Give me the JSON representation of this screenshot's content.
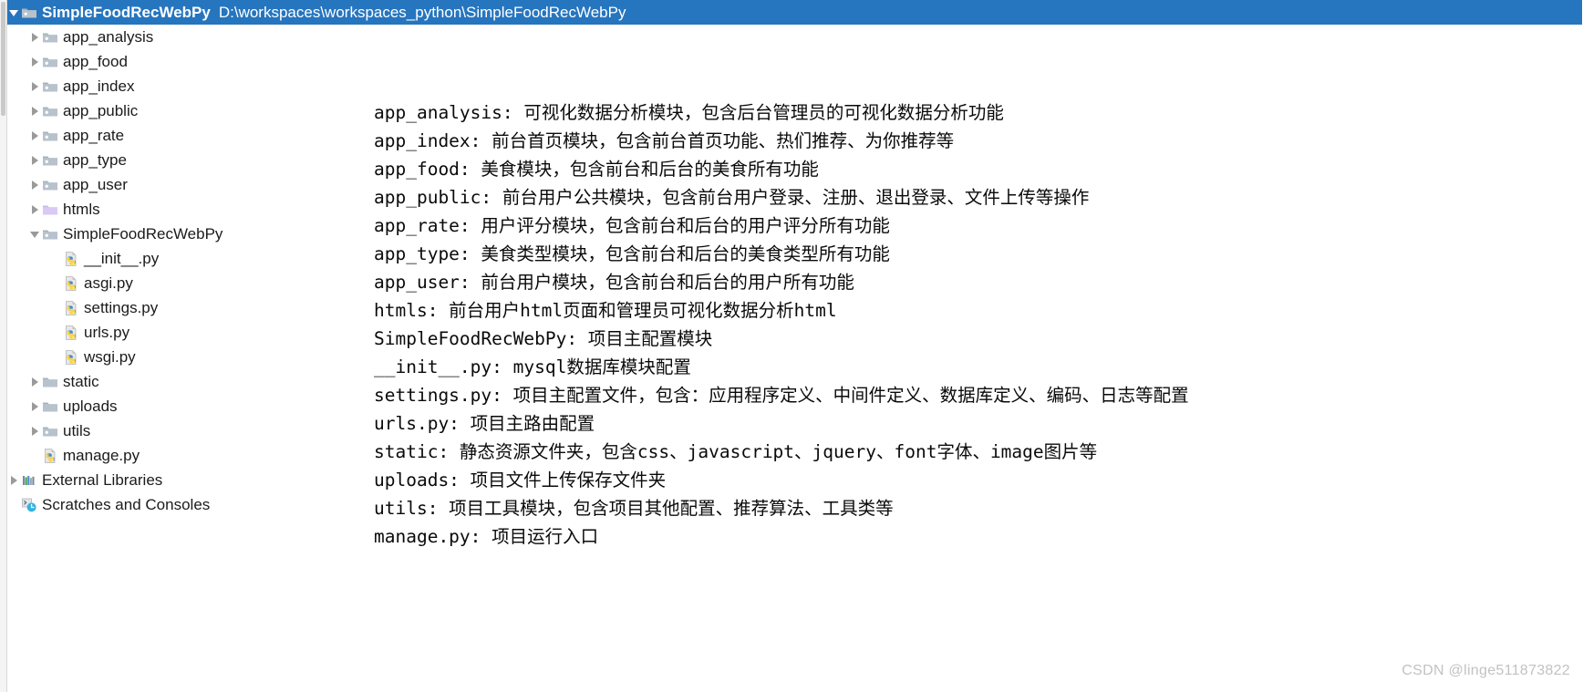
{
  "window": {
    "selected_row": {
      "name": "SimpleFoodRecWebPy",
      "path": "D:\\workspaces\\workspaces_python\\SimpleFoodRecWebPy",
      "highlight_color": "#2675bf"
    }
  },
  "tree": {
    "items": [
      {
        "label": "app_analysis",
        "icon": "module-folder-icon",
        "arrow": "right",
        "indent": 1
      },
      {
        "label": "app_food",
        "icon": "module-folder-icon",
        "arrow": "right",
        "indent": 1
      },
      {
        "label": "app_index",
        "icon": "module-folder-icon",
        "arrow": "right",
        "indent": 1
      },
      {
        "label": "app_public",
        "icon": "module-folder-icon",
        "arrow": "right",
        "indent": 1
      },
      {
        "label": "app_rate",
        "icon": "module-folder-icon",
        "arrow": "right",
        "indent": 1
      },
      {
        "label": "app_type",
        "icon": "module-folder-icon",
        "arrow": "right",
        "indent": 1
      },
      {
        "label": "app_user",
        "icon": "module-folder-icon",
        "arrow": "right",
        "indent": 1
      },
      {
        "label": "htmls",
        "icon": "template-folder-icon",
        "arrow": "right",
        "indent": 1
      },
      {
        "label": "SimpleFoodRecWebPy",
        "icon": "module-folder-icon",
        "arrow": "down",
        "indent": 1
      },
      {
        "label": "__init__.py",
        "icon": "python-file-icon",
        "arrow": "none",
        "indent": 2
      },
      {
        "label": "asgi.py",
        "icon": "python-file-icon",
        "arrow": "none",
        "indent": 2
      },
      {
        "label": "settings.py",
        "icon": "python-file-icon",
        "arrow": "none",
        "indent": 2
      },
      {
        "label": "urls.py",
        "icon": "python-file-icon",
        "arrow": "none",
        "indent": 2
      },
      {
        "label": "wsgi.py",
        "icon": "python-file-icon",
        "arrow": "none",
        "indent": 2
      },
      {
        "label": "static",
        "icon": "folder-icon",
        "arrow": "right",
        "indent": 1
      },
      {
        "label": "uploads",
        "icon": "folder-icon",
        "arrow": "right",
        "indent": 1
      },
      {
        "label": "utils",
        "icon": "module-folder-icon",
        "arrow": "right",
        "indent": 1
      },
      {
        "label": "manage.py",
        "icon": "python-file-icon",
        "arrow": "none",
        "indent": 1
      },
      {
        "label": "External Libraries",
        "icon": "external-libraries-icon",
        "arrow": "right",
        "indent": 0
      },
      {
        "label": "Scratches and Consoles",
        "icon": "scratches-icon",
        "arrow": "none",
        "indent": 0
      }
    ]
  },
  "description": {
    "lines": [
      "app_analysis: 可视化数据分析模块，包含后台管理员的可视化数据分析功能",
      "app_index: 前台首页模块，包含前台首页功能、热们推荐、为你推荐等",
      "app_food: 美食模块，包含前台和后台的美食所有功能",
      "app_public: 前台用户公共模块，包含前台用户登录、注册、退出登录、文件上传等操作",
      "app_rate: 用户评分模块，包含前台和后台的用户评分所有功能",
      "app_type: 美食类型模块，包含前台和后台的美食类型所有功能",
      "app_user: 前台用户模块，包含前台和后台的用户所有功能",
      "htmls: 前台用户html页面和管理员可视化数据分析html",
      "SimpleFoodRecWebPy: 项目主配置模块",
      "__init__.py: mysql数据库模块配置",
      "settings.py: 项目主配置文件，包含：应用程序定义、中间件定义、数据库定义、编码、日志等配置",
      "urls.py: 项目主路由配置",
      "static: 静态资源文件夹，包含css、javascript、jquery、font字体、image图片等",
      "uploads: 项目文件上传保存文件夹",
      "utils: 项目工具模块，包含项目其他配置、推荐算法、工具类等",
      "manage.py: 项目运行入口"
    ]
  },
  "watermark": {
    "text": "CSDN @linge511873822"
  }
}
